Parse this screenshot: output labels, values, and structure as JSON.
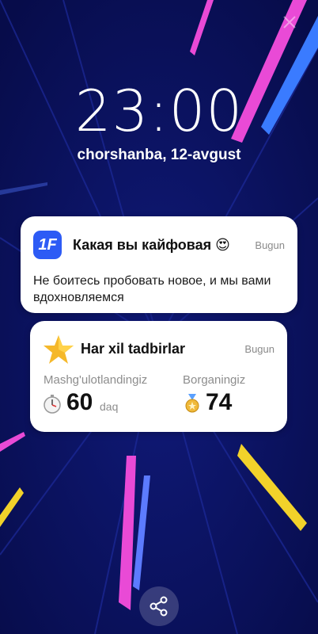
{
  "lockscreen": {
    "time": "23:00",
    "date": "chorshanba, 12-avgust"
  },
  "notification_1": {
    "app_icon_text": "1F",
    "title": "Какая вы кайфовая 😍",
    "time": "Bugun",
    "body": "Не боитесь пробовать новое, и мы вами вдохновляемся",
    "accent_color": "#2d5bf5"
  },
  "notification_2": {
    "icon": "star-icon",
    "title": "Har xil tadbirlar",
    "time": "Bugun",
    "stats": [
      {
        "label": "Mashg'ulotlandingiz",
        "value": "60",
        "unit": "daq",
        "icon": "stopwatch-icon"
      },
      {
        "label": "Borganingiz",
        "value": "74",
        "unit": "",
        "icon": "medal-icon"
      }
    ]
  },
  "actions": {
    "share_icon": "share-icon"
  },
  "colors": {
    "background": "#0b1160",
    "streak_pink": "#e94ad6",
    "streak_yellow": "#f2d22a",
    "streak_blue": "#3a7bff"
  }
}
